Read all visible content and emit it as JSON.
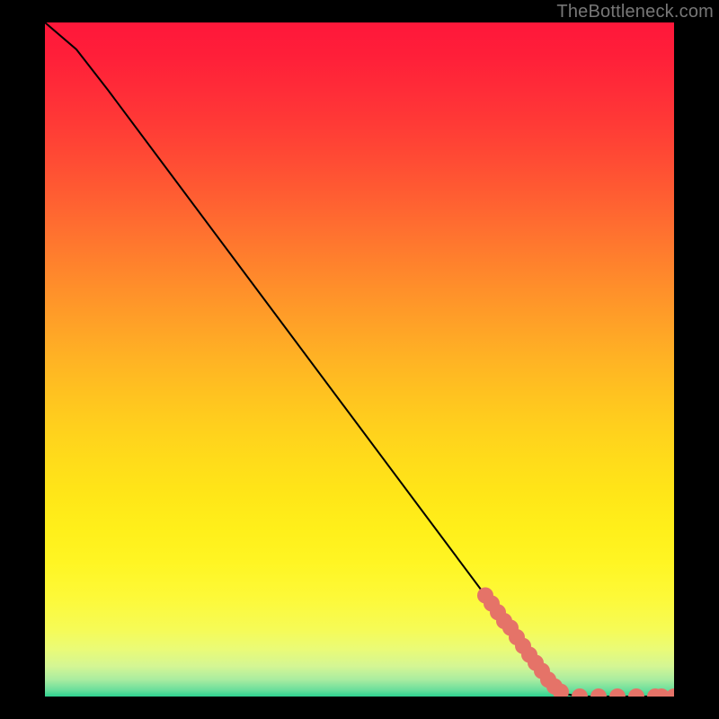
{
  "attribution": "TheBottleneck.com",
  "chart_data": {
    "type": "line",
    "title": "",
    "xlabel": "",
    "ylabel": "",
    "xlim": [
      0,
      100
    ],
    "ylim": [
      0,
      100
    ],
    "curve": [
      {
        "x": 0,
        "y": 100
      },
      {
        "x": 5,
        "y": 96
      },
      {
        "x": 10,
        "y": 90
      },
      {
        "x": 20,
        "y": 77.5
      },
      {
        "x": 30,
        "y": 65
      },
      {
        "x": 40,
        "y": 52.5
      },
      {
        "x": 50,
        "y": 40
      },
      {
        "x": 60,
        "y": 27.5
      },
      {
        "x": 70,
        "y": 15
      },
      {
        "x": 80,
        "y": 2.5
      },
      {
        "x": 82,
        "y": 0.5
      },
      {
        "x": 85,
        "y": 0
      },
      {
        "x": 100,
        "y": 0
      }
    ],
    "data_points": [
      {
        "x": 70,
        "y": 15.0
      },
      {
        "x": 71,
        "y": 13.8
      },
      {
        "x": 72,
        "y": 12.5
      },
      {
        "x": 73,
        "y": 11.2
      },
      {
        "x": 74,
        "y": 10.2
      },
      {
        "x": 75,
        "y": 8.8
      },
      {
        "x": 76,
        "y": 7.5
      },
      {
        "x": 77,
        "y": 6.2
      },
      {
        "x": 78,
        "y": 5.0
      },
      {
        "x": 79,
        "y": 3.8
      },
      {
        "x": 80,
        "y": 2.5
      },
      {
        "x": 81,
        "y": 1.5
      },
      {
        "x": 82,
        "y": 0.7
      },
      {
        "x": 85,
        "y": 0
      },
      {
        "x": 88,
        "y": 0
      },
      {
        "x": 91,
        "y": 0
      },
      {
        "x": 94,
        "y": 0
      },
      {
        "x": 97,
        "y": 0
      },
      {
        "x": 98,
        "y": 0
      },
      {
        "x": 100,
        "y": 0
      }
    ],
    "point_color": "#e57368",
    "line_color": "#000000",
    "background_gradient": {
      "type": "vertical",
      "stops": [
        {
          "offset": 0.0,
          "color": "#ff173a"
        },
        {
          "offset": 0.05,
          "color": "#ff1f39"
        },
        {
          "offset": 0.1,
          "color": "#ff2c38"
        },
        {
          "offset": 0.15,
          "color": "#ff3a36"
        },
        {
          "offset": 0.2,
          "color": "#ff4a34"
        },
        {
          "offset": 0.25,
          "color": "#ff5b32"
        },
        {
          "offset": 0.3,
          "color": "#ff6d30"
        },
        {
          "offset": 0.35,
          "color": "#ff7f2d"
        },
        {
          "offset": 0.4,
          "color": "#ff912a"
        },
        {
          "offset": 0.45,
          "color": "#ffa227"
        },
        {
          "offset": 0.5,
          "color": "#ffb324"
        },
        {
          "offset": 0.55,
          "color": "#ffc220"
        },
        {
          "offset": 0.6,
          "color": "#ffd01d"
        },
        {
          "offset": 0.65,
          "color": "#ffdc1a"
        },
        {
          "offset": 0.7,
          "color": "#ffe618"
        },
        {
          "offset": 0.75,
          "color": "#ffef1a"
        },
        {
          "offset": 0.8,
          "color": "#fff523"
        },
        {
          "offset": 0.85,
          "color": "#fdf937"
        },
        {
          "offset": 0.9,
          "color": "#f6fb56"
        },
        {
          "offset": 0.93,
          "color": "#eafb77"
        },
        {
          "offset": 0.955,
          "color": "#d4f694"
        },
        {
          "offset": 0.975,
          "color": "#a9eca0"
        },
        {
          "offset": 0.99,
          "color": "#6cdf9c"
        },
        {
          "offset": 1.0,
          "color": "#2dd28f"
        }
      ]
    }
  }
}
